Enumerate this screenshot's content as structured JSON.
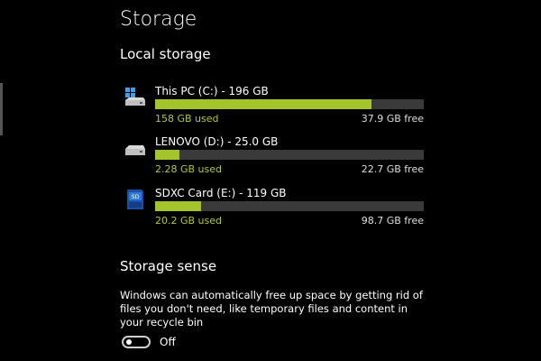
{
  "page": {
    "title": "Storage"
  },
  "local_storage": {
    "heading": "Local storage",
    "drives": [
      {
        "name": "This PC (C:) - 196 GB",
        "used": "158 GB used",
        "free": "37.9 GB free",
        "used_fraction": 0.806,
        "icon": "windows-drive-icon"
      },
      {
        "name": "LENOVO (D:) - 25.0 GB",
        "used": "2.28 GB used",
        "free": "22.7 GB free",
        "used_fraction": 0.091,
        "icon": "hard-drive-icon"
      },
      {
        "name": "SDXC Card (E:) - 119 GB",
        "used": "20.2 GB used",
        "free": "98.7 GB free",
        "used_fraction": 0.17,
        "icon": "sd-card-icon"
      }
    ]
  },
  "storage_sense": {
    "heading": "Storage sense",
    "description": "Windows can automatically free up space by getting rid of files you don't need, like temporary files and content in your recycle bin",
    "toggle_label": "Off",
    "toggle_on": false
  },
  "colors": {
    "background": "#000000",
    "bar_fill": "#a3c52b",
    "bar_track": "#3a3a3a",
    "used_text": "#b4c63a"
  }
}
